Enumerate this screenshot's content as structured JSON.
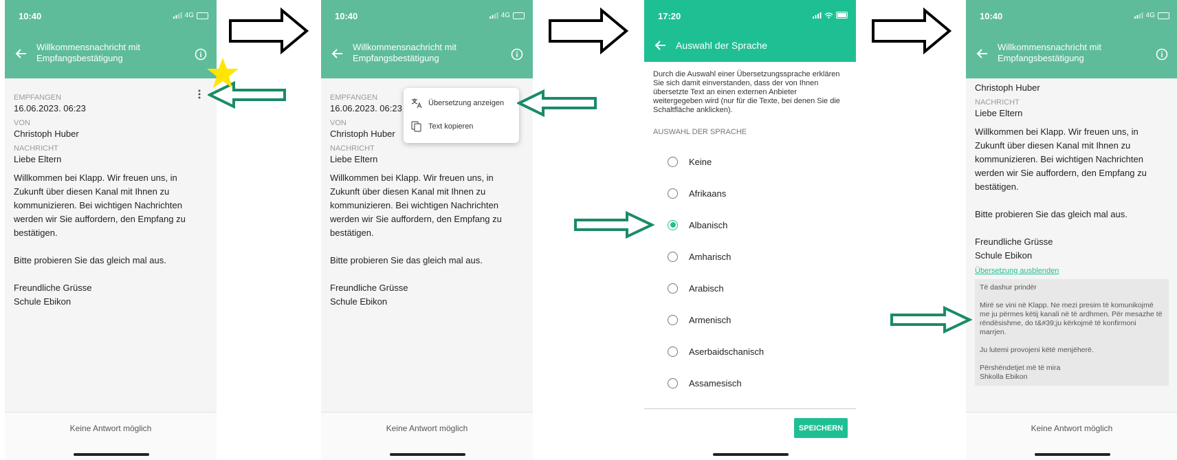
{
  "status": {
    "time_1": "10:40",
    "time_2": "10:40",
    "time_3": "17:20",
    "time_4": "10:40",
    "network": "4G"
  },
  "message_screen": {
    "title": "Willkommensnachricht mit Empfangsbestätigung",
    "received_label": "EMPFANGEN",
    "received_value": "16.06.2023. 06:23",
    "from_label": "VON",
    "from_value": "Christoph Huber",
    "message_label": "NACHRICHT",
    "greeting": "Liebe Eltern",
    "body": "Willkommen bei Klapp. Wir freuen uns, in Zukunft über diesen Kanal mit Ihnen zu kommunizieren. Bei wichtigen Nachrichten werden wir Sie auffordern, den Empfang zu bestätigen.\n\nBitte probieren Sie das gleich mal aus.\n\nFreundliche Grüsse\nSchule Ebikon",
    "footer": "Keine Antwort möglich"
  },
  "context_menu": {
    "show_translation": "Übersetzung anzeigen",
    "copy_text": "Text kopieren"
  },
  "language_screen": {
    "title": "Auswahl der Sprache",
    "disclaimer": "Durch die Auswahl einer Übersetzungssprache erklären Sie sich damit einverstanden, dass der von Ihnen übersetzte Text an einen externen Anbieter weitergegeben wird (nur für die Texte, bei denen Sie die Schaltfläche anklicken).",
    "section_label": "AUSWAHL DER SPRACHE",
    "languages": [
      "Keine",
      "Afrikaans",
      "Albanisch",
      "Amharisch",
      "Arabisch",
      "Armenisch",
      "Aserbaidschanisch",
      "Assamesisch"
    ],
    "selected": "Albanisch",
    "save": "SPEICHERN"
  },
  "translated_screen": {
    "from_value": "Christoph Huber",
    "message_label": "NACHRICHT",
    "greeting": "Liebe Eltern",
    "body": "Willkommen bei Klapp. Wir freuen uns, in Zukunft über diesen Kanal mit Ihnen zu kommunizieren. Bei wichtigen Nachrichten werden wir Sie auffordern, den Empfang zu bestätigen.\n\nBitte probieren Sie das gleich mal aus.\n\nFreundliche Grüsse\nSchule Ebikon",
    "hide_translation": "Übersetzung ausblenden",
    "translation": "Të dashur prindër\n\nMirë se vini në Klapp. Ne mezi presim të komunikojmë me ju përmes këtij kanali në të ardhmen. Për mesazhe të rëndësishme, do t&#39;ju kërkojmë të konfirmoni marrjen.\n\nJu lutemi provojeni këtë menjëherë.\n\nPërshëndetjet më të mira\nShkolla Ebikon",
    "footer": "Keine Antwort möglich"
  },
  "colors": {
    "header_green": "#5ebc9b",
    "header_teal": "#1fbf94",
    "arrow_green": "#1a8a6a",
    "star": "#ffe600"
  }
}
